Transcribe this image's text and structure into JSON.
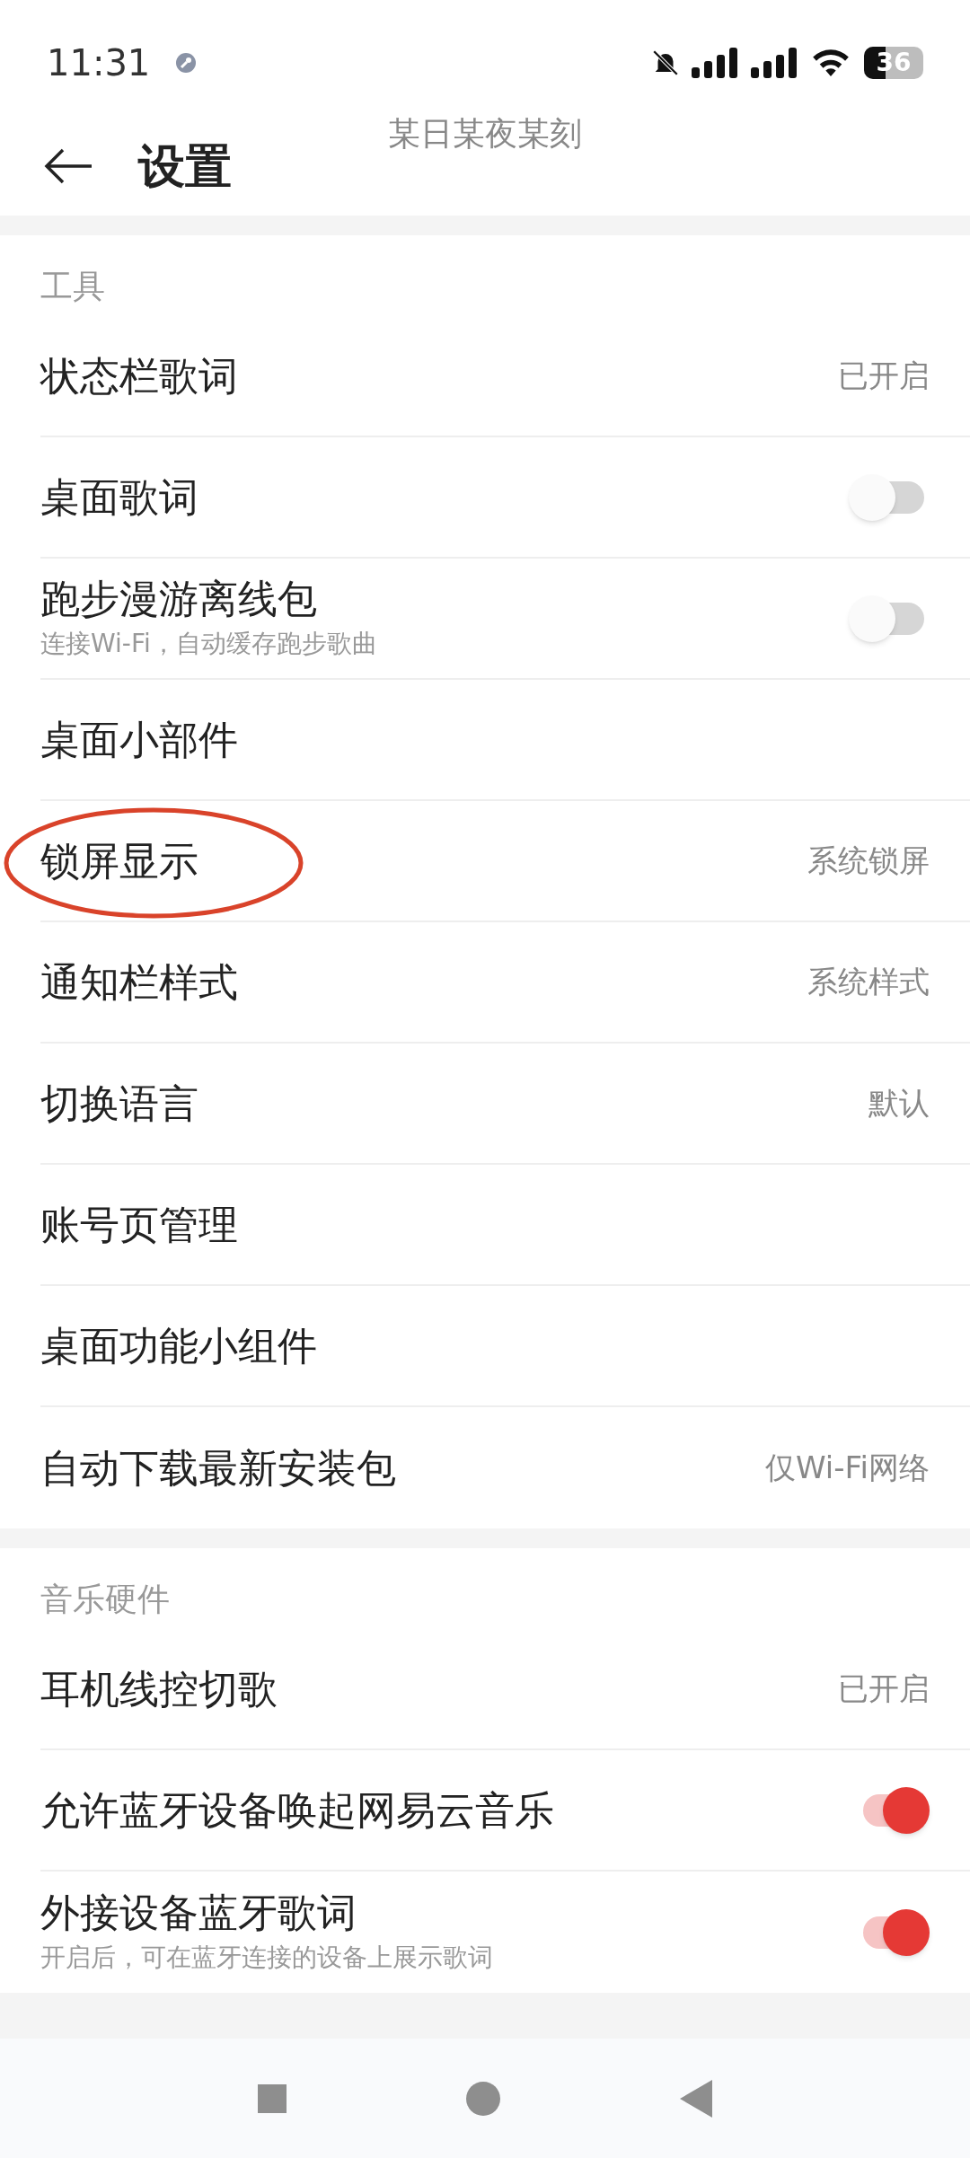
{
  "status_bar": {
    "time": "11:31",
    "battery": "36"
  },
  "header": {
    "title": "设置",
    "marquee": "某日某夜某刻"
  },
  "sections": [
    {
      "title": "工具",
      "items": [
        {
          "kind": "value",
          "label": "状态栏歌词",
          "value": "已开启"
        },
        {
          "kind": "toggle",
          "label": "桌面歌词",
          "on": false
        },
        {
          "kind": "toggle",
          "label": "跑步漫游离线包",
          "subtitle": "连接Wi-Fi，自动缓存跑步歌曲",
          "on": false
        },
        {
          "kind": "link",
          "label": "桌面小部件"
        },
        {
          "kind": "value",
          "label": "锁屏显示",
          "value": "系统锁屏",
          "circled": true
        },
        {
          "kind": "value",
          "label": "通知栏样式",
          "value": "系统样式"
        },
        {
          "kind": "value",
          "label": "切换语言",
          "value": "默认"
        },
        {
          "kind": "link",
          "label": "账号页管理"
        },
        {
          "kind": "link",
          "label": "桌面功能小组件"
        },
        {
          "kind": "value",
          "label": "自动下载最新安装包",
          "value": "仅Wi-Fi网络"
        }
      ]
    },
    {
      "title": "音乐硬件",
      "items": [
        {
          "kind": "value",
          "label": "耳机线控切歌",
          "value": "已开启"
        },
        {
          "kind": "toggle",
          "label": "允许蓝牙设备唤起网易云音乐",
          "on": true
        },
        {
          "kind": "toggle",
          "label": "外接设备蓝牙歌词",
          "subtitle": "开启后，可在蓝牙连接的设备上展示歌词",
          "on": true
        }
      ]
    }
  ]
}
